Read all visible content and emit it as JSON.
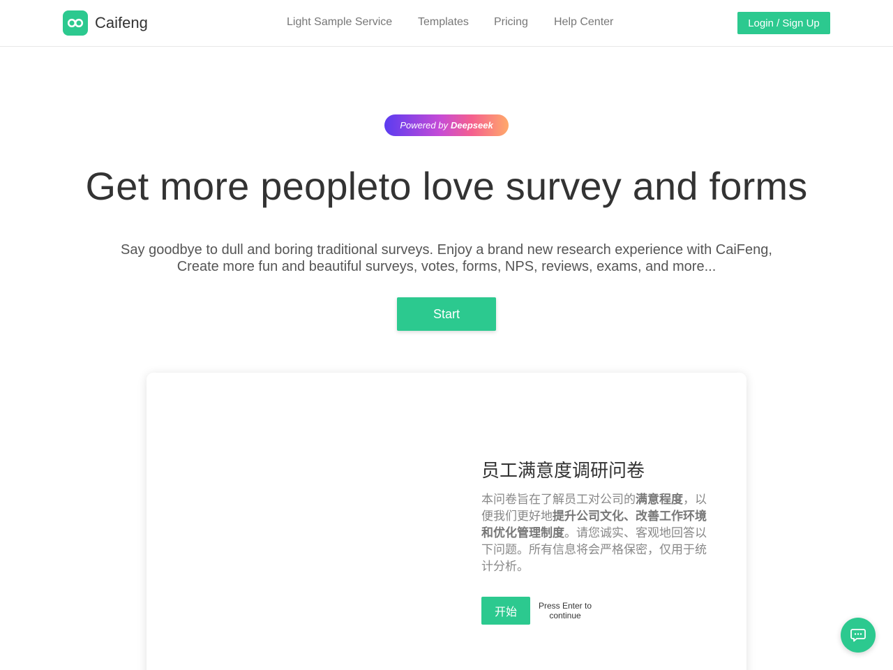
{
  "brand": {
    "name": "Caifeng",
    "logo_icon": "infinity-icon",
    "accent": "#2cc98f"
  },
  "nav": {
    "items": [
      {
        "label": "Light Sample Service"
      },
      {
        "label": "Templates"
      },
      {
        "label": "Pricing"
      },
      {
        "label": "Help Center"
      }
    ],
    "login_label": "Login / Sign Up"
  },
  "hero": {
    "badge_prefix": "Powered by",
    "badge_brand": "Deepseek",
    "title": "Get more peopleto love survey and forms",
    "subtitle_line1": "Say goodbye to dull and boring traditional surveys. Enjoy a brand new research experience with CaiFeng,",
    "subtitle_line2": "Create more fun and beautiful surveys, votes, forms, NPS, reviews, exams, and more...",
    "start_label": "Start"
  },
  "preview": {
    "survey_title": "员工满意度调研问卷",
    "desc_parts": [
      {
        "text": "本问卷旨在了解员工对公司的",
        "bold": false
      },
      {
        "text": "满意程度",
        "bold": true
      },
      {
        "text": "，以便我们更好地",
        "bold": false
      },
      {
        "text": "提升公司文化、改善工作环境和优化管理制度",
        "bold": true
      },
      {
        "text": "。请您诚实、客观地回答以下问题。所有信息将会严格保密，仅用于统计分析。",
        "bold": false
      }
    ],
    "begin_label": "开始",
    "enter_hint": "Press Enter to continue"
  },
  "chat": {
    "icon": "chat-bubble-icon"
  }
}
